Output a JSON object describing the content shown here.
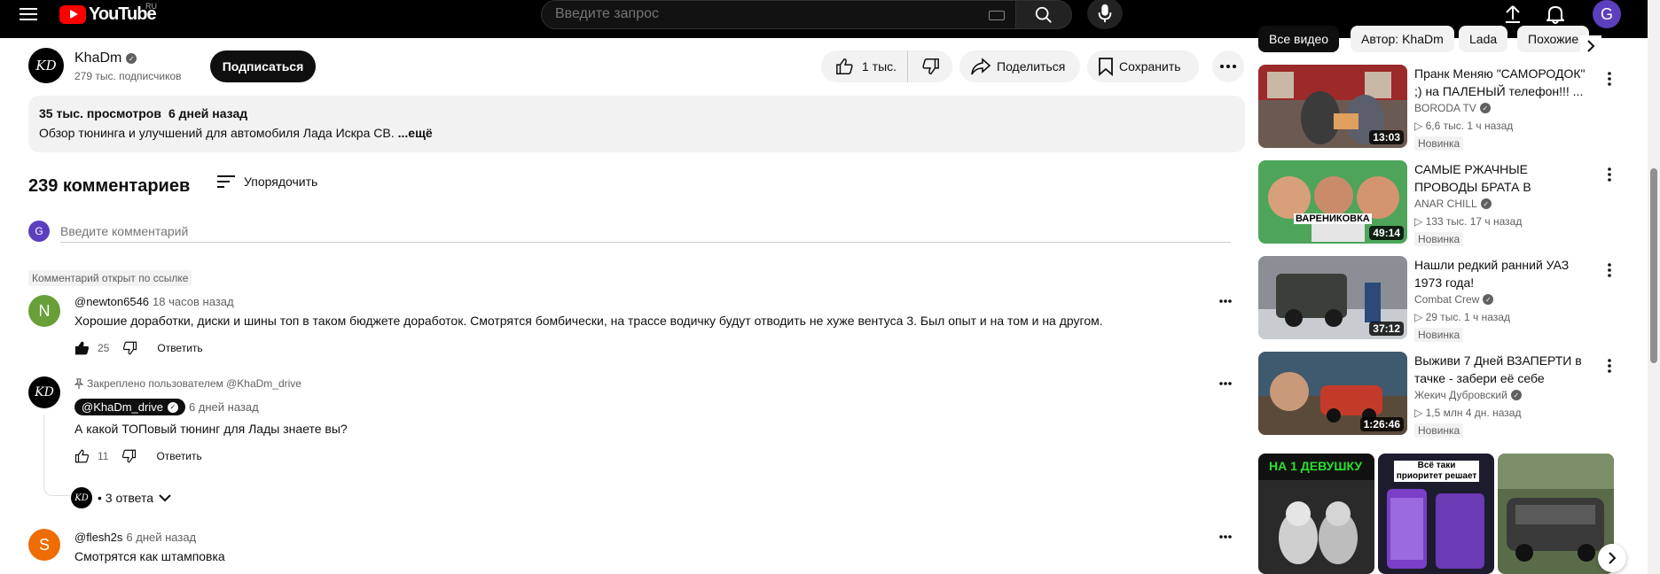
{
  "header": {
    "logo_text": "YouTube",
    "region": "RU",
    "search_placeholder": "Введите запрос",
    "avatar_letter": "G"
  },
  "channel": {
    "avatar_text": "KD",
    "name": "KhaDm",
    "subscribers": "279 тыс. подписчиков",
    "subscribe_label": "Подписаться"
  },
  "actions": {
    "likes": "1 тыс.",
    "share": "Поделиться",
    "save": "Сохранить"
  },
  "description": {
    "views": "35 тыс. просмотров",
    "date": "6 дней назад",
    "text": "Обзор тюнинга и улучшений для автомобиля Лада Искра СВ.",
    "more": "...ещё"
  },
  "comments_section": {
    "count": "239 комментариев",
    "sort_label": "Упорядочить",
    "input_placeholder": "Введите комментарий",
    "my_avatar": "G",
    "linked_badge": "Комментарий открыт по ссылке"
  },
  "comments": [
    {
      "avatar": "N",
      "avatar_color": "#689f38",
      "author": "@newton6546",
      "time": "18 часов назад",
      "text": "Хорошие доработки, диски и шины топ в таком бюджете доработок. Смотрятся бомбически, на трассе водичку будут отводить не хуже вентуса 3. Был опыт и на том и на другом.",
      "likes": "25",
      "reply": "Ответить"
    },
    {
      "avatar": "KD",
      "pinned": "Закреплено пользователем @KhaDm_drive",
      "author": "@KhaDm_drive",
      "time": "6 дней назад",
      "text": "А какой ТОПовый тюнинг для Лады знаете вы?",
      "likes": "11",
      "reply": "Ответить",
      "replies_avatar": "KD",
      "replies_label": "• 3 ответа"
    },
    {
      "avatar": "S",
      "avatar_color": "#ef6c00",
      "author": "@flesh2s",
      "time": "6 дней назад",
      "text": "Смотрятся как штамповка"
    }
  ],
  "chips": [
    "Все видео",
    "Автор: KhaDm",
    "Lada",
    "Похожие"
  ],
  "recommendations": [
    {
      "title": "Пранк Меняю \"САМОРОДОК\" ;) на ПАЛЕНЫЙ телефон!!! ...",
      "channel": "BORODA TV",
      "meta": "▷ 6,6 тыс.   1 ч назад",
      "badge": "Новинка",
      "duration": "13:03"
    },
    {
      "title": "САМЫЕ РЖАЧНЫЕ ПРОВОДЫ БРАТА В ДЕРЕВНЕ У ДЕДА С ...",
      "channel": "ANAR CHILL",
      "meta": "▷ 133 тыс.   17 ч назад",
      "badge": "Новинка",
      "duration": "49:14",
      "thumb_text": "ВАРЕНИКОВКА"
    },
    {
      "title": "Нашли редкий ранний УАЗ 1973 года!",
      "channel": "Combat Crew",
      "meta": "▷ 29 тыс.   1 ч назад",
      "badge": "Новинка",
      "duration": "37:12"
    },
    {
      "title": "Выживи 7 Дней ВЗАПЕРТИ в тачке - забери её себе",
      "channel": "Жекич Дубровский",
      "meta": "▷ 1,5 млн   4 дн. назад",
      "badge": "Новинка",
      "duration": "1:26:46"
    }
  ],
  "shorts": [
    {
      "text": "НА 1 ДЕВУШКУ"
    },
    {
      "text": "Всё таки приоритет решает"
    },
    {
      "text": ""
    }
  ]
}
